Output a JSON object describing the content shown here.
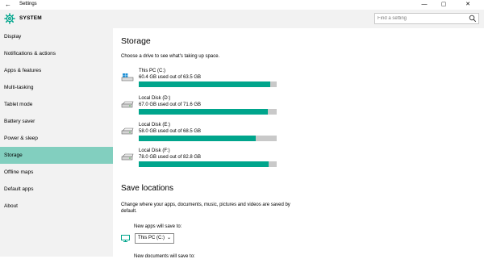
{
  "window": {
    "title": "Settings",
    "back_glyph": "←",
    "min_glyph": "—",
    "max_glyph": "▢",
    "close_glyph": "✕"
  },
  "header": {
    "section": "SYSTEM",
    "search_placeholder": "Find a setting",
    "icon": "gear-icon",
    "accent": "#00a58c"
  },
  "sidebar": {
    "items": [
      {
        "label": "Display"
      },
      {
        "label": "Notifications & actions"
      },
      {
        "label": "Apps & features"
      },
      {
        "label": "Multi-tasking"
      },
      {
        "label": "Tablet mode"
      },
      {
        "label": "Battery saver"
      },
      {
        "label": "Power & sleep"
      },
      {
        "label": "Storage"
      },
      {
        "label": "Offline maps"
      },
      {
        "label": "Default apps"
      },
      {
        "label": "About"
      }
    ],
    "active_index": 7,
    "active_color": "#82cfbf"
  },
  "storage": {
    "title": "Storage",
    "description": "Choose a drive to see what's taking up space.",
    "drives": [
      {
        "name": "This PC (C:)",
        "usage": "60.4 GB used out of 63.5 GB",
        "fraction": 0.951,
        "icon": "windows-drive-icon"
      },
      {
        "name": "Local Disk (D:)",
        "usage": "67.0 GB used out of 71.6 GB",
        "fraction": 0.936,
        "icon": "disk-drive-icon"
      },
      {
        "name": "Local Disk (E:)",
        "usage": "58.0 GB used out of 68.5 GB",
        "fraction": 0.847,
        "icon": "disk-drive-icon"
      },
      {
        "name": "Local Disk (F:)",
        "usage": "78.0 GB used out of 82.8 GB",
        "fraction": 0.942,
        "icon": "disk-drive-icon"
      }
    ]
  },
  "save_locations": {
    "title": "Save locations",
    "description": "Change where your apps, documents, music, pictures and videos are saved by default.",
    "new_apps_label": "New apps will save to:",
    "new_apps_value": "This PC (C:)",
    "dropdown_chevron": "⌄",
    "next_label_partial": "New documents will save to:"
  }
}
